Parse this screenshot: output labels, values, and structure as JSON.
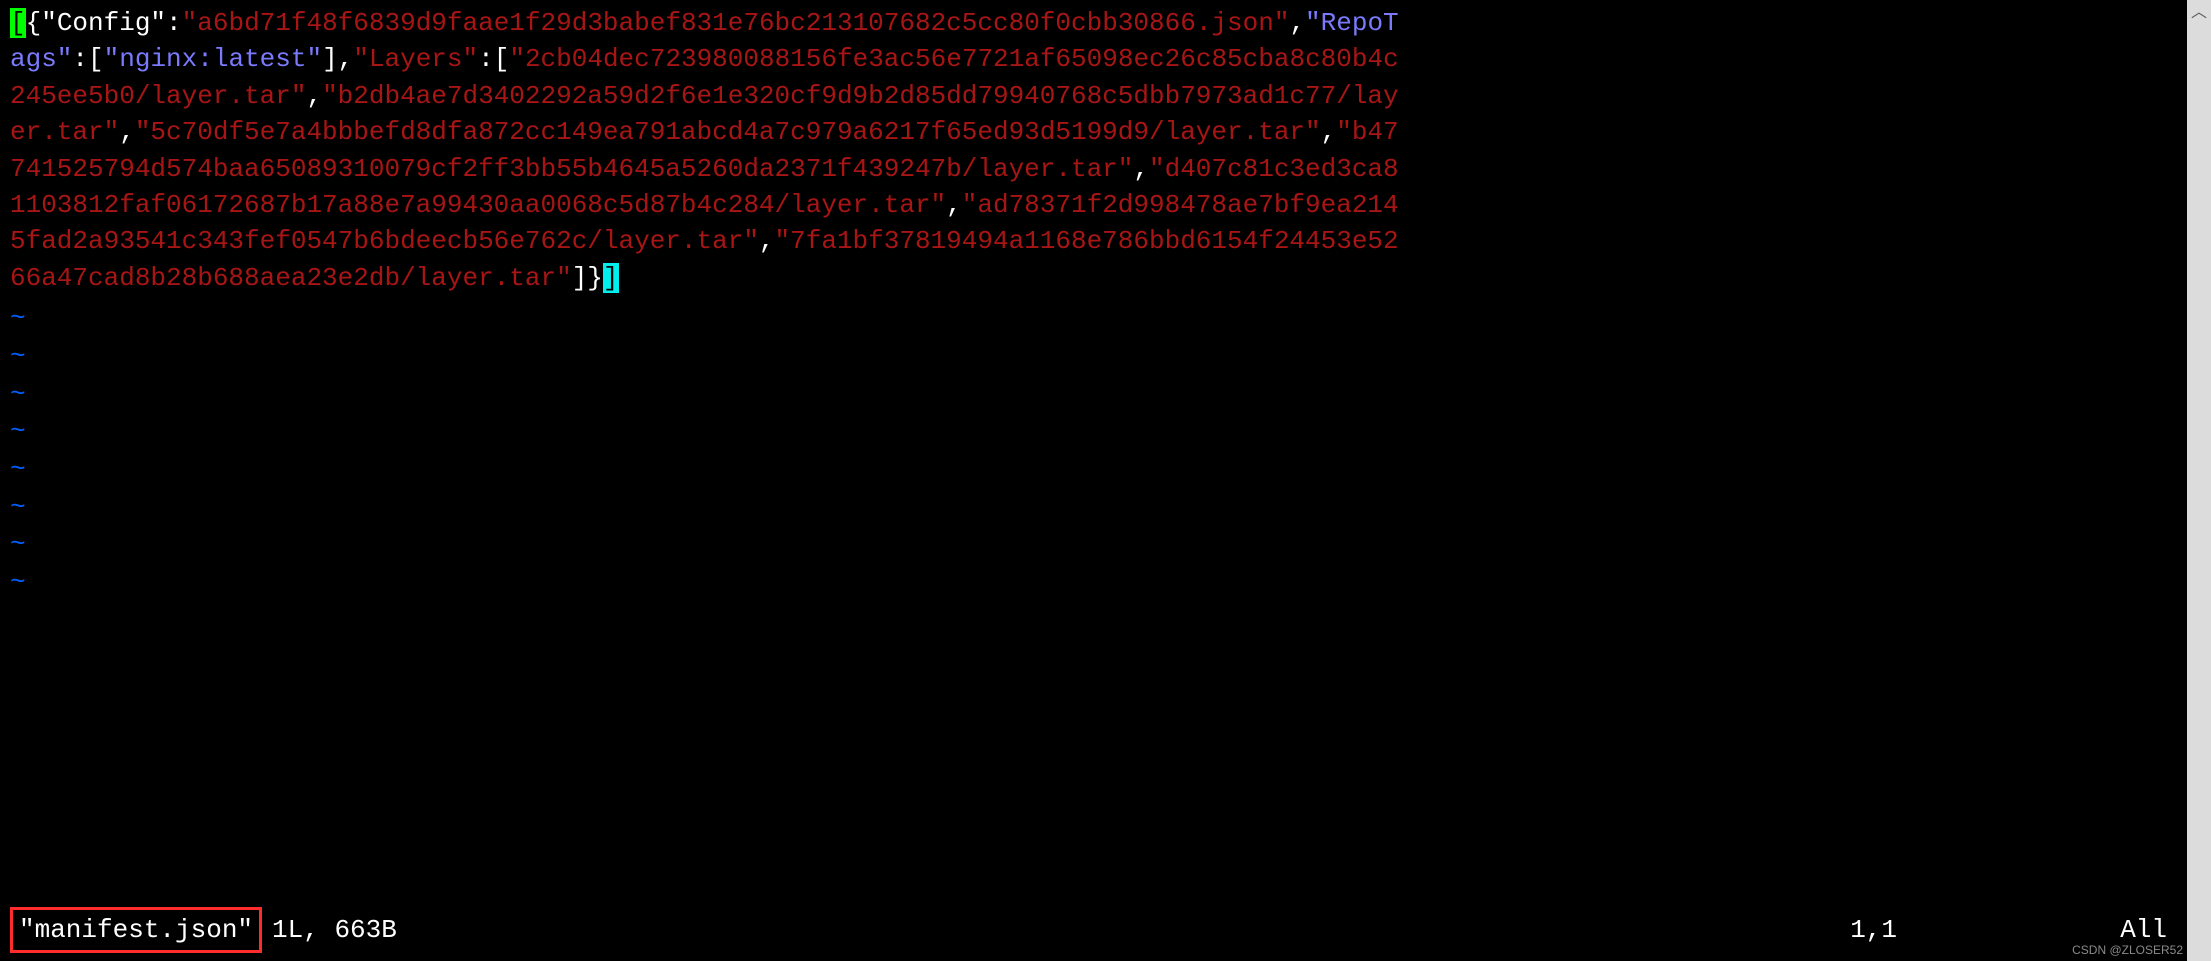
{
  "json_display": {
    "config_key": "\"Config\"",
    "config_val": "\"a6bd71f48f6839d9faae1f29d3babef831e76bc213107682c5cc80f0cbb30866.json\"",
    "repotags_key_part1": "\"RepoT",
    "repotags_key_part2": "ags\"",
    "repotags_val": "\"nginx:latest\"",
    "layers_key": "\"Layers\"",
    "layer1a": "\"2cb04dec723980088156fe3ac56e7721af65098ec26c85cba8c80b4c",
    "layer1b": "245ee5b0/layer.tar\"",
    "layer2a": "\"b2db4ae7d3402292a59d2f6e1e320cf9d9b2d85dd79940768c5dbb7973ad1c77/lay",
    "layer2b": "er.tar\"",
    "layer3": "\"5c70df5e7a4bbbefd8dfa872cc149ea791abcd4a7c979a6217f65ed93d5199d9/layer.tar\"",
    "layer4a": "\"b47",
    "layer4b": "741525794d574baa65089310079cf2ff3bb55b4645a5260da2371f439247b/layer.tar\"",
    "layer5a": "\"d407c81c3ed3ca8",
    "layer5b": "1103812faf06172687b17a88e7a99430aa0068c5d87b4c284/layer.tar\"",
    "layer6a": "\"ad78371f2d998478ae7bf9ea214",
    "layer6b": "5fad2a93541c343fef0547b6bdeecb56e762c/layer.tar\"",
    "layer7a": "\"7fa1bf37819494a1168e786bbd6154f24453e52",
    "layer7b": "66a47cad8b28b688aea23e2db/layer.tar\""
  },
  "status": {
    "filename": "\"manifest.json\"",
    "fileinfo": "1L, 663B",
    "cursor": "1,1",
    "scroll": "All"
  },
  "watermark": "CSDN @ZLOSER52",
  "scroll_arrow": "︿",
  "tilde": "~"
}
